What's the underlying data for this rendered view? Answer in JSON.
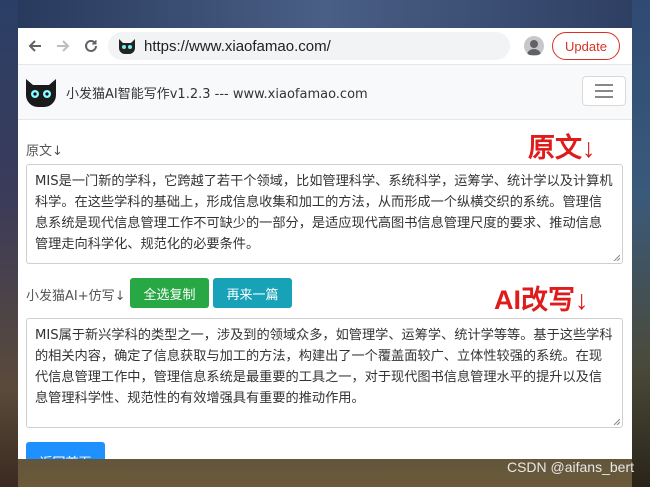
{
  "browser": {
    "url": "https://www.xiaofamao.com/",
    "update_label": "Update"
  },
  "app": {
    "brand": "小发猫AI智能写作v1.2.3 --- www.xiaofamao.com"
  },
  "original": {
    "label": "原文↓",
    "annotation": "原文↓",
    "text": "MIS是一门新的学科，它跨越了若干个领域，比如管理科学、系统科学，运筹学、统计学以及计算机科学。在这些学科的基础上，形成信息收集和加工的方法，从而形成一个纵横交织的系统。管理信息系统是现代信息管理工作不可缺少的一部分，是适应现代高图书信息管理尺度的要求、推动信息管理走向科学化、规范化的必要条件。"
  },
  "rewrite": {
    "label": "小发猫AI+仿写↓",
    "annotation": "AI改写↓",
    "copy_all_label": "全选复制",
    "again_label": "再来一篇",
    "text": "MIS属于新兴学科的类型之一，涉及到的领域众多，如管理学、运筹学、统计学等等。基于这些学科的相关内容，确定了信息获取与加工的方法，构建出了一个覆盖面较广、立体性较强的系统。在现代信息管理工作中，管理信息系统是最重要的工具之一，对于现代图书信息管理水平的提升以及信息管理科学性、规范性的有效增强具有重要的推动作用。"
  },
  "footer": {
    "back_home_label": "返回首页"
  },
  "watermark": "CSDN @aifans_bert"
}
